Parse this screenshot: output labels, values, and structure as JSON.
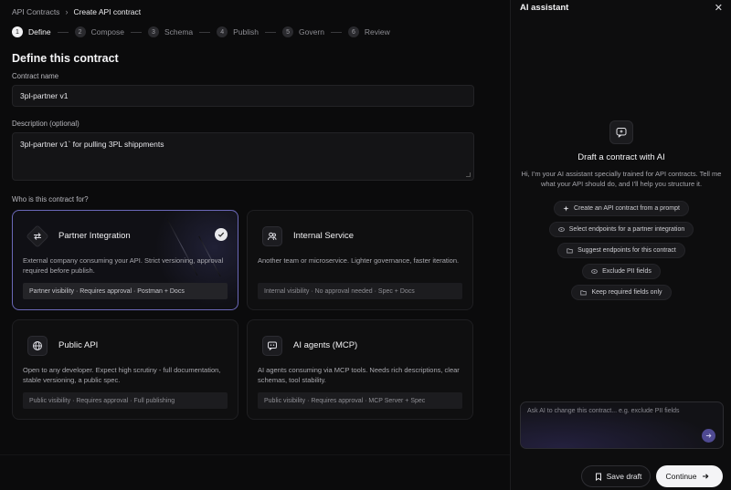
{
  "breadcrumb": {
    "parent": "API Contracts",
    "current": "Create API contract"
  },
  "steps": [
    {
      "num": "1",
      "label": "Define"
    },
    {
      "num": "2",
      "label": "Compose"
    },
    {
      "num": "3",
      "label": "Schema"
    },
    {
      "num": "4",
      "label": "Publish"
    },
    {
      "num": "5",
      "label": "Govern"
    },
    {
      "num": "6",
      "label": "Review"
    }
  ],
  "active_step": "Define",
  "section_title": "Define this contract",
  "form": {
    "name_label": "Contract name",
    "name_value": "3pl-partner v1",
    "desc_label": "Description (optional)",
    "desc_value": "3pl-partner v1` for pulling 3PL shippments",
    "audience_label": "Who is this contract for?"
  },
  "cards": [
    {
      "title": "Partner Integration",
      "desc": "External company consuming your API. Strict versioning, approval required before publish.",
      "tags": "Partner visibility · Requires approval · Postman + Docs",
      "icon": "arrows-exchange-icon",
      "selected": true
    },
    {
      "title": "Internal Service",
      "desc": "Another team or microservice. Lighter governance, faster iteration.",
      "tags": "Internal visibility · No approval needed · Spec + Docs",
      "icon": "users-icon",
      "selected": false
    },
    {
      "title": "Public API",
      "desc": "Open to any developer. Expect high scrutiny - full documentation, stable versioning, a public spec.",
      "tags": "Public visibility · Requires approval · Full publishing",
      "icon": "globe-icon",
      "selected": false
    },
    {
      "title": "AI agents (MCP)",
      "desc": "AI agents consuming via MCP tools. Needs rich descriptions, clear schemas, tool stability.",
      "tags": "Public visibility · Requires approval · MCP Server + Spec",
      "icon": "ai-agent-icon",
      "selected": false
    }
  ],
  "ai": {
    "title": "AI assistant",
    "heading": "Draft a contract with AI",
    "intro": "Hi, I'm your AI assistant specially trained for API contracts. Tell me what your API should do, and I'll help you structure it.",
    "suggestions": [
      {
        "label": "Create an API contract from a prompt",
        "icon": "sparkle-icon"
      },
      {
        "label": "Select endpoints for a partner integration",
        "icon": "eye-icon"
      },
      {
        "label": "Suggest endpoints for this contract",
        "icon": "folder-icon"
      },
      {
        "label": "Exclude PII fields",
        "icon": "eye-icon"
      },
      {
        "label": "Keep required fields only",
        "icon": "folder-icon"
      }
    ],
    "input_placeholder": "Ask AI to change this contract... e.g. exclude PII fields"
  },
  "actions": {
    "save_draft": "Save draft",
    "continue": "Continue"
  },
  "colors": {
    "accent": "#6b68b8",
    "send": "#4f4a92",
    "background": "#0b0b0c"
  }
}
